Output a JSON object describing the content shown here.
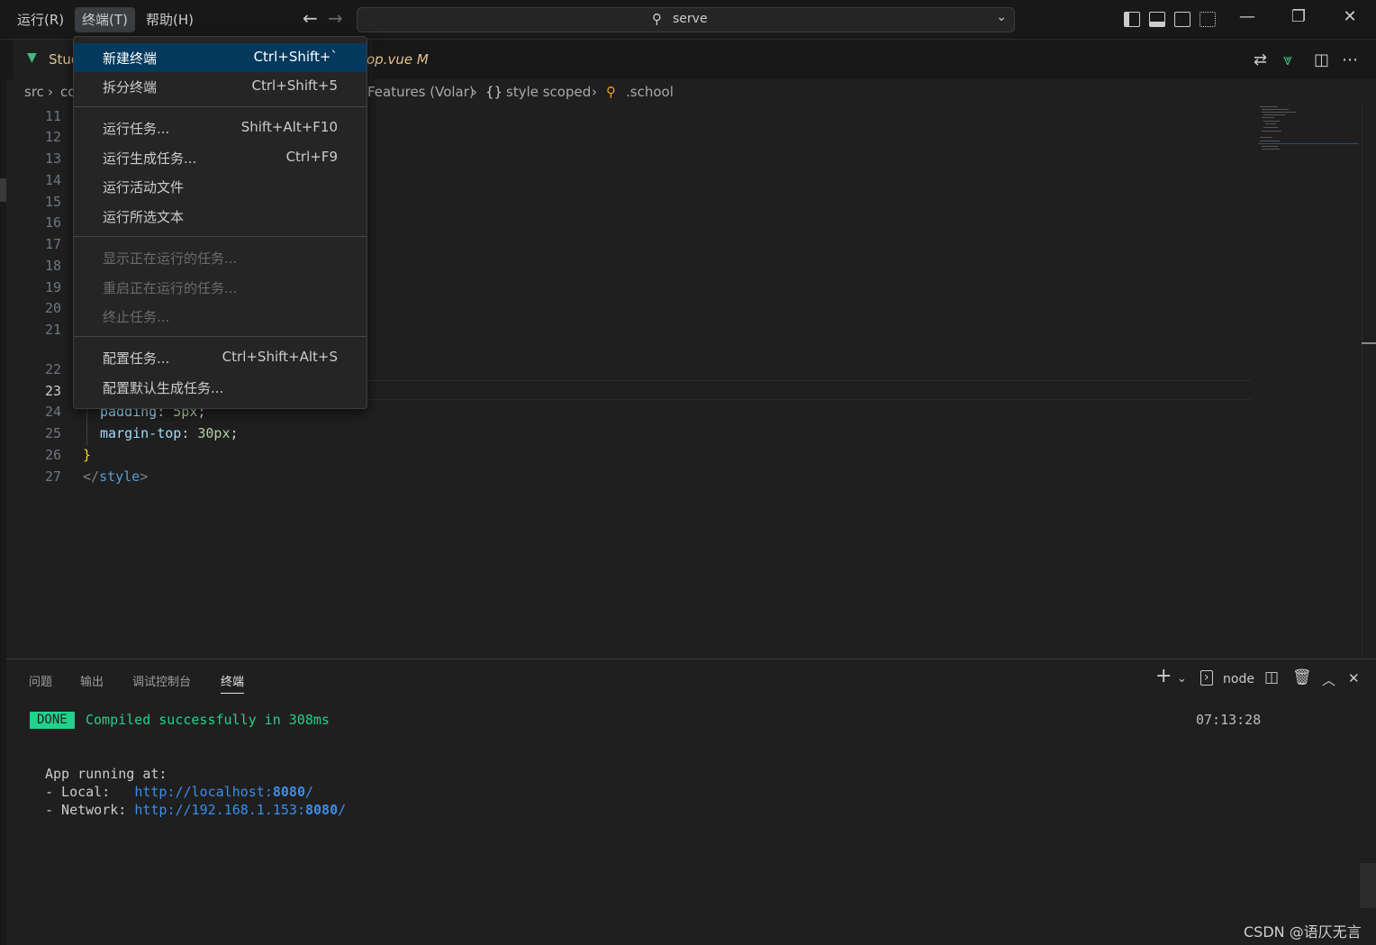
{
  "titlebar": {
    "menus": [
      "运行(R)",
      "终端(T)",
      "帮助(H)"
    ],
    "command_center": "serve"
  },
  "tabs": {
    "active_tab_prefix": "Stud",
    "active_tab_suffix": "op.vue",
    "modified_marker": "M"
  },
  "breadcrumb": {
    "parts": [
      "src",
      "cc",
      "Features (Volar)",
      "style scoped",
      ".school"
    ]
  },
  "editor": {
    "line_numbers": [
      "11",
      "12",
      "13",
      "14",
      "15",
      "16",
      "17",
      "18",
      "19",
      "20",
      "21",
      "22",
      "23",
      "24",
      "25",
      "26",
      "27"
    ],
    "current_line": "23",
    "code": {
      "l24_prop": "padding",
      "l24_val": "5px",
      "l25_prop": "margin-top",
      "l25_val": "30px",
      "l26": "}",
      "l27_open": "</",
      "l27_tag": "style",
      "l27_close": ">"
    }
  },
  "terminal_menu": {
    "items": [
      {
        "label": "新建终端",
        "key": "Ctrl+Shift+`"
      },
      {
        "label": "拆分终端",
        "key": "Ctrl+Shift+5"
      },
      {
        "label": "运行任务...",
        "key": "Shift+Alt+F10"
      },
      {
        "label": "运行生成任务...",
        "key": "Ctrl+F9"
      },
      {
        "label": "运行活动文件",
        "key": ""
      },
      {
        "label": "运行所选文本",
        "key": ""
      },
      {
        "label": "显示正在运行的任务...",
        "key": ""
      },
      {
        "label": "重启正在运行的任务...",
        "key": ""
      },
      {
        "label": "终止任务...",
        "key": ""
      },
      {
        "label": "配置任务...",
        "key": "Ctrl+Shift+Alt+S"
      },
      {
        "label": "配置默认生成任务...",
        "key": ""
      }
    ]
  },
  "panel": {
    "tabs": [
      "问题",
      "输出",
      "调试控制台",
      "终端"
    ],
    "active_tab": "终端",
    "shell": "node"
  },
  "terminal": {
    "done": "DONE",
    "compiled": "Compiled successfully in 308ms",
    "time": "07:13:28",
    "running": "App running at:",
    "local_label": "- Local:   ",
    "local_url": "http://localhost:",
    "local_port": "8080",
    "network_label": "- Network: ",
    "network_url": "http://192.168.1.153:",
    "network_port": "8080",
    "slash": "/"
  },
  "watermark": "CSDN @语仄无言",
  "colors": {
    "accent_highlight": "#04395e",
    "done_badge": "#23d18b",
    "link": "#3b8eea",
    "vue_green": "#42b883"
  }
}
